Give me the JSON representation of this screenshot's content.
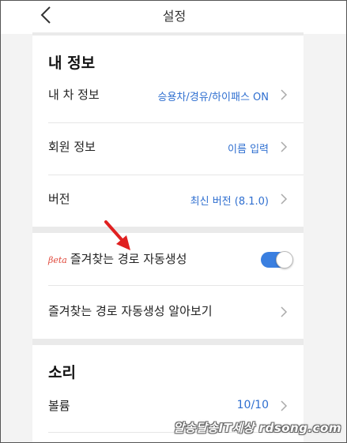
{
  "header": {
    "title": "설정"
  },
  "sections": {
    "my_info": {
      "title": "내 정보",
      "rows": [
        {
          "label": "내 차 정보",
          "value": "승용차/경유/하이패스 ON"
        },
        {
          "label": "회원 정보",
          "value": "이름 입력"
        },
        {
          "label": "버전",
          "value": "최신 버전 (8.1.0)"
        }
      ]
    },
    "routes": {
      "beta_tag": "βeta",
      "auto_label": "즐겨찾는 경로 자동생성",
      "auto_enabled": true,
      "learn_label": "즐겨찾는 경로 자동생성 알아보기"
    },
    "sound": {
      "title": "소리",
      "volume_label": "볼륨",
      "volume_value": "10/10"
    }
  },
  "watermark": "알송달송IT세상 rdsong.com",
  "colors": {
    "accent": "#2f6fd0",
    "toggle_on": "#3a7fe0",
    "beta": "#e0493c",
    "arrow": "#e02020"
  },
  "icons": [
    "chevron-left-icon",
    "chevron-right-icon",
    "red-arrow-icon"
  ]
}
